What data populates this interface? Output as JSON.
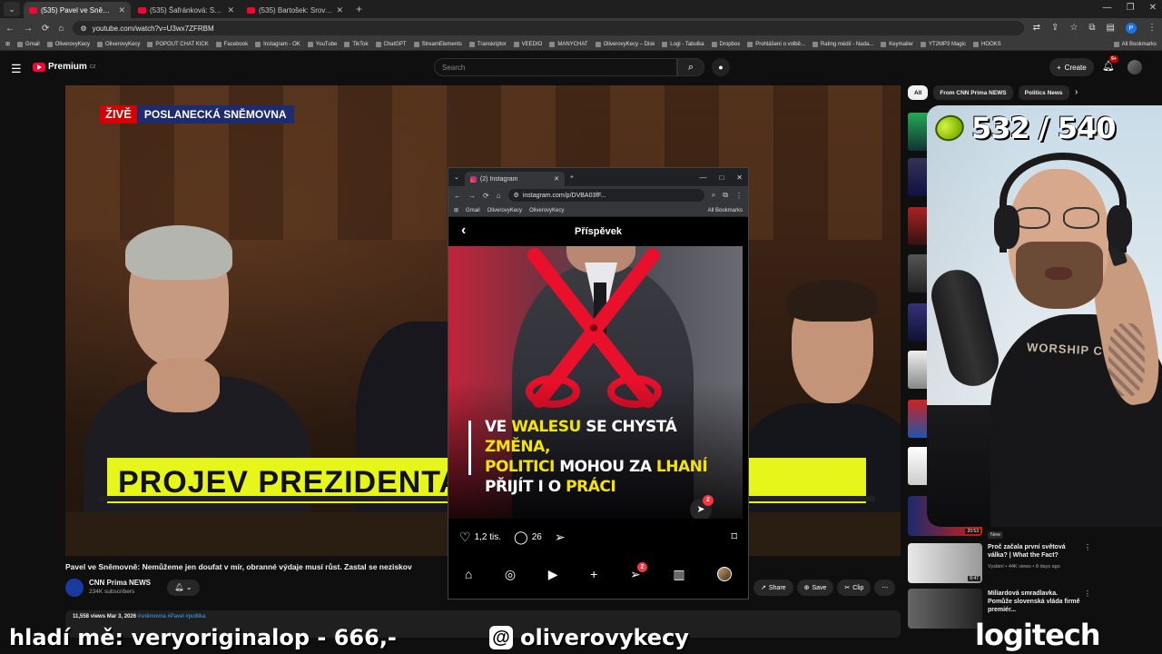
{
  "browser": {
    "tabs": [
      {
        "label": "(535) Pavel ve Sněmovně: N"
      },
      {
        "label": "(535) Šafránková: SPD v tuto c"
      },
      {
        "label": "(535) Bartošek: Srovnávat Írán a"
      }
    ],
    "url": "youtube.com/watch?v=U3wx7ZFRBM",
    "bookmarks": [
      "Gmail",
      "OliverovyKecy",
      "OliverovyKecy",
      "POPOUT CHAT KICK",
      "Facebook",
      "Instagram - OK",
      "YouTube",
      "TikTok",
      "ChatGPT",
      "StreamElements",
      "Transkriptor",
      "VEEDIO",
      "MANYCHAT",
      "OliverovyKecy – Disk",
      "Logi - Tabulka",
      "Dropbox",
      "Prohlášení o volbě...",
      "Rating médií - Nada...",
      "Keymailer",
      "YT2MP3 Magic",
      "HOOKS"
    ],
    "all_bookmarks": "All Bookmarks"
  },
  "youtube": {
    "logo": "Premium",
    "logo_region": "CZ",
    "search_placeholder": "Search",
    "create_label": "Create",
    "notif_count": "9+"
  },
  "video": {
    "live_label": "ŽIVĚ",
    "location_label": "POSLANECKÁ SNĚMOVNA",
    "banner_text": "PROJEV PREZIDENTA",
    "title": "Pavel ve Sněmovně: Nemůžeme jen doufat v mír, obranné výdaje musí růst. Zastal se neziskov",
    "channel_name": "CNN Prima NEWS",
    "channel_subs": "234K subscribers",
    "actions": [
      "Share",
      "Save",
      "Clip"
    ],
    "desc_stats": "11,558 views  Mar 3, 2026",
    "desc_tags": "#sněmovna #Pavel #politika"
  },
  "instagram": {
    "tab_label": "(2) Instagram",
    "url": "instagram.com/p/DVBA03fF...",
    "bookmarks": [
      "Gmail",
      "OliverovyKecy",
      "OliverovyKecy"
    ],
    "all_bookmarks": "All Bookmarks",
    "header": "Příspěvek",
    "caption": {
      "l1a": "VE ",
      "l1b": "WALESU",
      "l1c": " SE CHYSTÁ ",
      "l1d": "ZMĚNA,",
      "l2a": "POLITICI",
      "l2b": " MOHOU ZA ",
      "l2c": "LHANÍ",
      "l3a": "PŘIJÍT I O ",
      "l3b": "PRÁCI"
    },
    "likes": "1,2 tis.",
    "comments": "26",
    "dm_badge": "2",
    "nav_badge": "2"
  },
  "sidebar": {
    "chips": [
      "All",
      "From CNN Prima NEWS",
      "Politics News"
    ],
    "recommended": [
      {
        "title": "",
        "meta": "",
        "duration": "20:53"
      },
      {
        "title": "Proč začala první světová válka? | What the Fact?",
        "meta": "Vyslání • 44K views • 8 days ago",
        "duration": "8:47",
        "tag": "New"
      },
      {
        "title": "Miliardová smradlavka. Pomůže slovenská vláda firmě premiér...",
        "meta": "",
        "duration": ""
      }
    ]
  },
  "stream": {
    "score": "532 / 540",
    "shirt_text": "WORSHIP COFFEE",
    "ticker": "hladí mě: veryoriginalop - 666,-",
    "threads_handle": "oliverovykecy",
    "sponsor": "logitech"
  }
}
